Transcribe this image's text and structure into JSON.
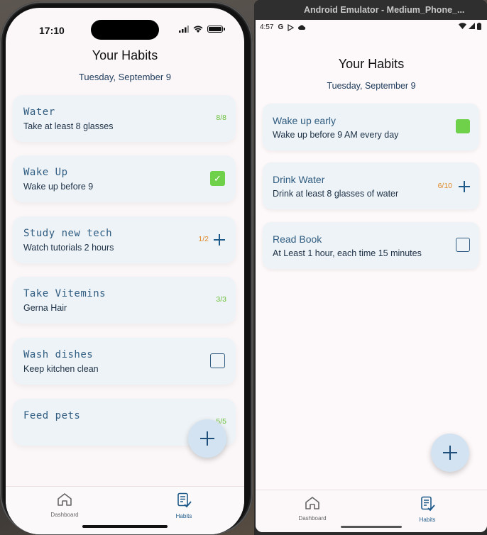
{
  "ios": {
    "status_time": "17:10",
    "title": "Your Habits",
    "date": "Tuesday, September 9",
    "habits": [
      {
        "name": "Water",
        "desc": "Take at least 8 glasses",
        "count": "8/8"
      },
      {
        "name": "Wake Up",
        "desc": "Wake up before 9",
        "checked": "✓"
      },
      {
        "name": "Study new tech",
        "desc": "Watch tutorials 2 hours",
        "count": "1/2"
      },
      {
        "name": "Take Vitemins",
        "desc": "Gerna Hair",
        "count": "3/3"
      },
      {
        "name": "Wash dishes",
        "desc": "Keep kitchen clean"
      },
      {
        "name": "Feed pets",
        "desc": "",
        "count": "5/5"
      }
    ],
    "nav": {
      "dashboard": "Dashboard",
      "habits": "Habits"
    }
  },
  "android": {
    "window_title": "Android Emulator - Medium_Phone_...",
    "status_time": "4:57",
    "status_g": "G",
    "title": "Your Habits",
    "date": "Tuesday, September 9",
    "habits": [
      {
        "name": "Wake up early",
        "desc": "Wake up before 9 AM every day"
      },
      {
        "name": "Drink Water",
        "desc": "Drink at least 8 glasses of water",
        "count": "6/10"
      },
      {
        "name": "Read Book",
        "desc": "At Least 1 hour, each time 15 minutes"
      }
    ],
    "nav": {
      "dashboard": "Dashboard",
      "habits": "Habits"
    }
  },
  "colors": {
    "accent": "#1d5a8a",
    "done": "#6cbf3a",
    "progress": "#e08a2a",
    "card": "#eef3f7"
  }
}
